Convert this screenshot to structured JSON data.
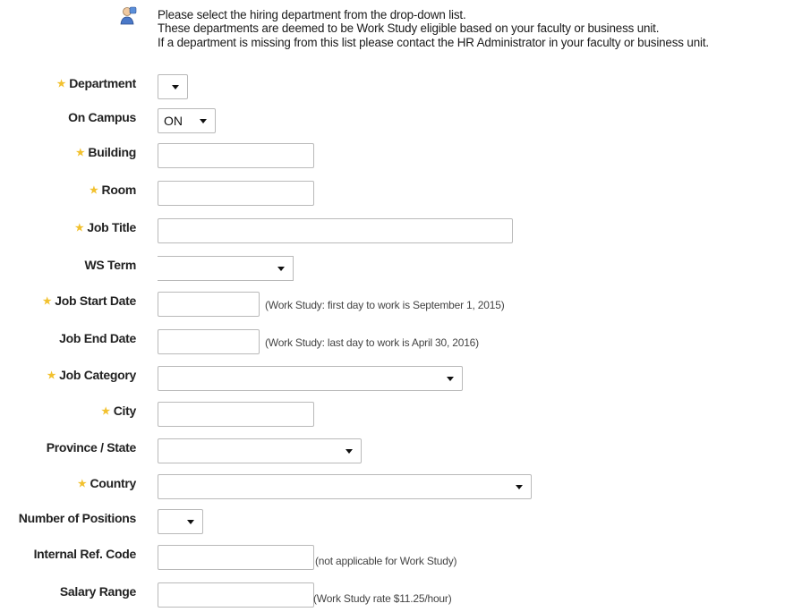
{
  "info": {
    "icon": "info-person-icon",
    "lines": [
      "Please select the hiring department from the drop-down list.",
      "These departments are deemed to be Work Study eligible based on your faculty or business unit.",
      "If a department is missing from this list please contact the HR Administrator in your faculty or business unit."
    ]
  },
  "colors": {
    "required_star": "#f2c12e",
    "border": "#b9b9b9"
  },
  "fields": {
    "department": {
      "label": "Department",
      "required": true,
      "value": ""
    },
    "on_campus": {
      "label": "On Campus",
      "required": false,
      "value": "ON"
    },
    "building": {
      "label": "Building",
      "required": true,
      "value": ""
    },
    "room": {
      "label": "Room",
      "required": true,
      "value": ""
    },
    "job_title": {
      "label": "Job Title",
      "required": true,
      "value": ""
    },
    "ws_term": {
      "label": "WS Term",
      "required": false,
      "value": ""
    },
    "job_start_date": {
      "label": "Job Start Date",
      "required": true,
      "value": "",
      "hint": "(Work Study: first day to work is September 1, 2015)"
    },
    "job_end_date": {
      "label": "Job End Date",
      "required": false,
      "value": "",
      "hint": "(Work Study: last day to work is April 30, 2016)"
    },
    "job_category": {
      "label": "Job Category",
      "required": true,
      "value": ""
    },
    "city": {
      "label": "City",
      "required": true,
      "value": ""
    },
    "province_state": {
      "label": "Province / State",
      "required": false,
      "value": ""
    },
    "country": {
      "label": "Country",
      "required": true,
      "value": ""
    },
    "number_of_positions": {
      "label": "Number of Positions",
      "required": false,
      "value": ""
    },
    "internal_ref_code": {
      "label": "Internal Ref. Code",
      "required": false,
      "value": "",
      "hint": "(not applicable for Work Study)"
    },
    "salary_range": {
      "label": "Salary Range",
      "required": false,
      "value": "",
      "hint": "(Work Study rate $11.25/hour)"
    }
  },
  "star_glyph": "★"
}
